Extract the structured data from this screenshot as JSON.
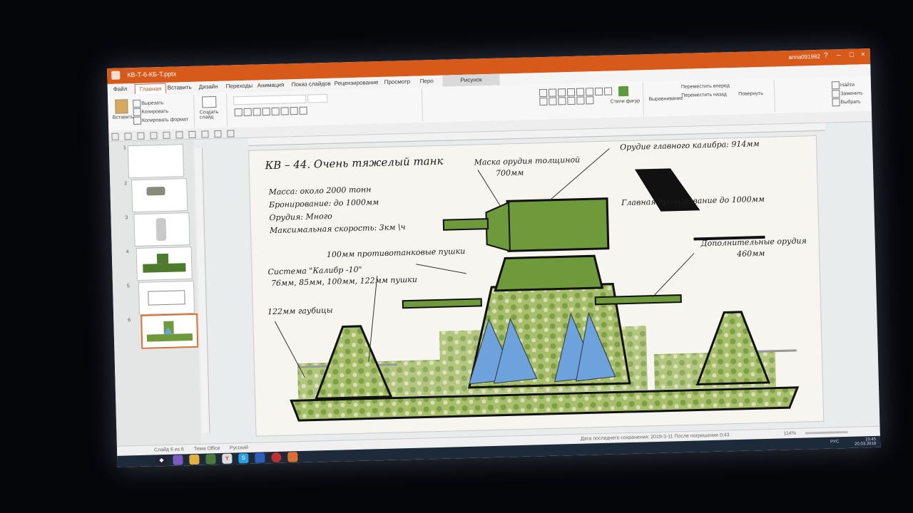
{
  "window": {
    "filename": "КВ-Т-6-КБ-Т.pptx",
    "user": "anna091982",
    "controls": [
      "?",
      "–",
      "□",
      "×"
    ]
  },
  "ribbon_tabs": [
    {
      "label": "Файл"
    },
    {
      "label": "Главная"
    },
    {
      "label": "Вставить"
    },
    {
      "label": "Дизайн"
    },
    {
      "label": "Переходы"
    },
    {
      "label": "Анимация"
    },
    {
      "label": "Показ слайдов"
    },
    {
      "label": "Рецензирование"
    },
    {
      "label": "Просмотр"
    },
    {
      "label": "Перо"
    }
  ],
  "context_tab": "Рисунок",
  "ribbon": {
    "paste": "Вставить",
    "cut": "Вырезать",
    "copy": "Копировать",
    "format_painter": "Копировать формат",
    "new_slide": "Создать слайд",
    "shape_styles": "Стили фигур",
    "arrange": "Выравнивание",
    "bring_forward": "Переместить вперед",
    "send_backward": "Переместить назад",
    "rotate": "Повернуть",
    "find": "Найти",
    "replace": "Заменить",
    "select": "Выбрать"
  },
  "thumbnails": [
    "1",
    "2",
    "3",
    "4",
    "5",
    "6"
  ],
  "slide": {
    "title": "КВ – 44. Очень тяжелый танк",
    "stats": [
      "Масса: около 2000 тонн",
      "Бронирование: до 1000мм",
      "Орудия: Много",
      "Максимальная скорость: 3км \\ч"
    ],
    "labels": {
      "mask": "Маска орудия толщиной",
      "mask_value": "700мм",
      "main_gun": "Орудие главного калибра: 914мм",
      "main_armor": "Главная бронирование до 1000мм",
      "at_guns": "100мм противотанковые пушки",
      "system": "Система \"Калибр -10\"",
      "calibres": "76мм, 85мм, 100мм, 122мм пушки",
      "howitzers": "122мм гаубицы",
      "extra_guns": "Дополнительные орудия",
      "extra_guns_value": "460мм"
    }
  },
  "status": {
    "slide_info": "Слайд 6 из 6",
    "theme": "Тема Office",
    "lang": "Русский",
    "saved": "Дата последнего сохранения: 2019-3-11 После погрешения 0:43",
    "zoom": "114%"
  },
  "tray": {
    "time": "10:45",
    "date": "20.03.2019",
    "lang": "РУС"
  },
  "colors": {
    "accent": "#d85a1a",
    "tank_green": "#6f9a3c",
    "spike_blue": "#6ea2dc"
  }
}
